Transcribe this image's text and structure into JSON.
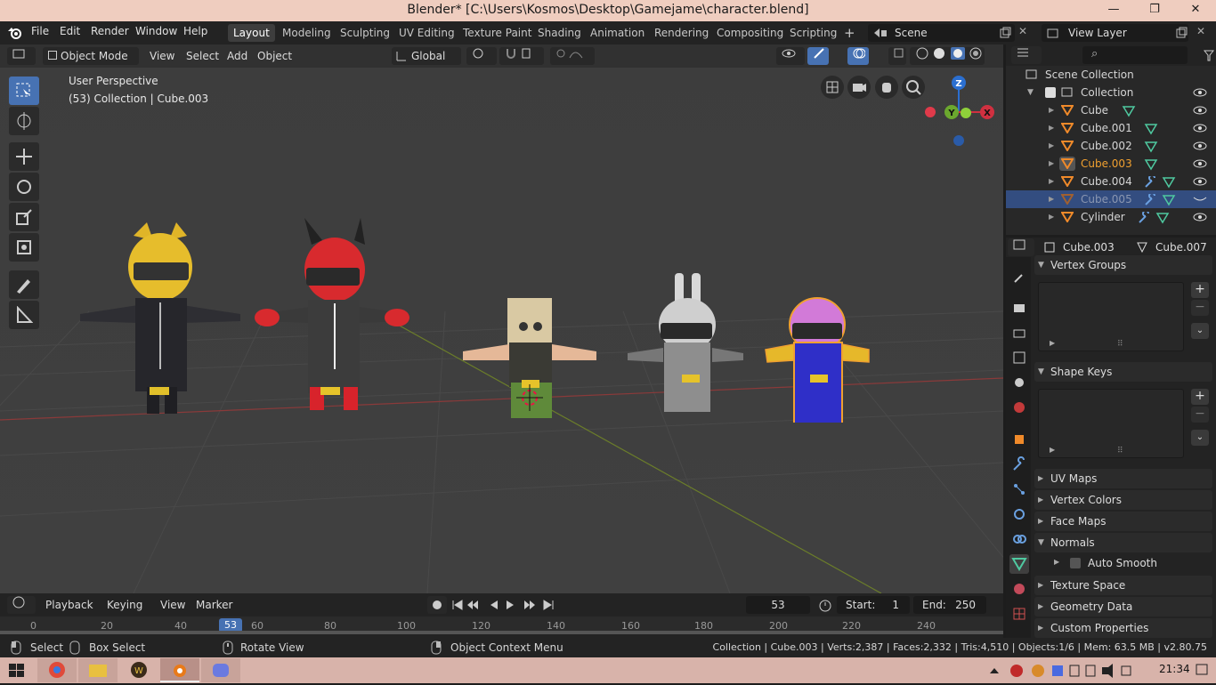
{
  "window": {
    "title": "Blender* [C:\\Users\\Kosmos\\Desktop\\Gamejame\\character.blend]",
    "controls": [
      "—",
      "❐",
      "✕"
    ]
  },
  "menu": [
    "File",
    "Edit",
    "Render",
    "Window",
    "Help"
  ],
  "workspaces": [
    {
      "label": "Layout",
      "active": true
    },
    {
      "label": "Modeling"
    },
    {
      "label": "Sculpting"
    },
    {
      "label": "UV Editing"
    },
    {
      "label": "Texture Paint"
    },
    {
      "label": "Shading"
    },
    {
      "label": "Animation"
    },
    {
      "label": "Rendering"
    },
    {
      "label": "Compositing"
    },
    {
      "label": "Scripting"
    }
  ],
  "add_workspace": "+",
  "scene": {
    "label": "Scene"
  },
  "view_layer": {
    "label": "View Layer"
  },
  "viewport_header": {
    "mode": "Object Mode",
    "menus": [
      "View",
      "Select",
      "Add",
      "Object"
    ],
    "transform_orientation": "Global"
  },
  "viewport": {
    "perspective": "User Perspective",
    "collection_info": "(53) Collection | Cube.003",
    "gizmo": {
      "z": "Z",
      "y": "Y",
      "x": "X"
    }
  },
  "outliner": {
    "search_placeholder": "",
    "root": "Scene Collection",
    "collection": "Collection",
    "items": [
      {
        "name": "Cube",
        "selected": false,
        "modifier": false
      },
      {
        "name": "Cube.001",
        "selected": false,
        "modifier": false
      },
      {
        "name": "Cube.002",
        "selected": false,
        "modifier": false
      },
      {
        "name": "Cube.003",
        "selected": false,
        "active": true,
        "modifier": false
      },
      {
        "name": "Cube.004",
        "selected": false,
        "modifier": true
      },
      {
        "name": "Cube.005",
        "selected": true,
        "modifier": true,
        "hidden": true
      },
      {
        "name": "Cylinder",
        "selected": false,
        "modifier": true
      }
    ]
  },
  "properties": {
    "object": "Cube.003",
    "mesh": "Cube.007",
    "panels": [
      {
        "label": "Vertex Groups",
        "open": true
      },
      {
        "label": "Shape Keys",
        "open": true
      },
      {
        "label": "UV Maps",
        "open": false
      },
      {
        "label": "Vertex Colors",
        "open": false
      },
      {
        "label": "Face Maps",
        "open": false
      },
      {
        "label": "Normals",
        "open": true
      },
      {
        "label": "Texture Space",
        "open": false
      },
      {
        "label": "Geometry Data",
        "open": false
      },
      {
        "label": "Custom Properties",
        "open": false
      }
    ],
    "auto_smooth_label": "Auto Smooth"
  },
  "timeline": {
    "menus": [
      "Playback",
      "Keying",
      "View",
      "Marker"
    ],
    "current_frame": "53",
    "start_label": "Start:",
    "start": "1",
    "end_label": "End:",
    "end": "250",
    "ruler_ticks": [
      "0",
      "20",
      "40",
      "53",
      "60",
      "80",
      "100",
      "120",
      "140",
      "160",
      "180",
      "200",
      "220",
      "240"
    ]
  },
  "statusbar": {
    "select": "Select",
    "box_select": "Box Select",
    "rotate_view": "Rotate View",
    "context_menu": "Object Context Menu",
    "stats": "Collection | Cube.003 | Verts:2,387 | Faces:2,332 | Tris:4,510 | Objects:1/6 | Mem: 63.5 MB | v2.80.75"
  },
  "taskbar": {
    "clock": "21:34"
  },
  "colors": {
    "accent": "#4772b3",
    "active_object": "#f0a030",
    "selection_row": "#334d80"
  }
}
